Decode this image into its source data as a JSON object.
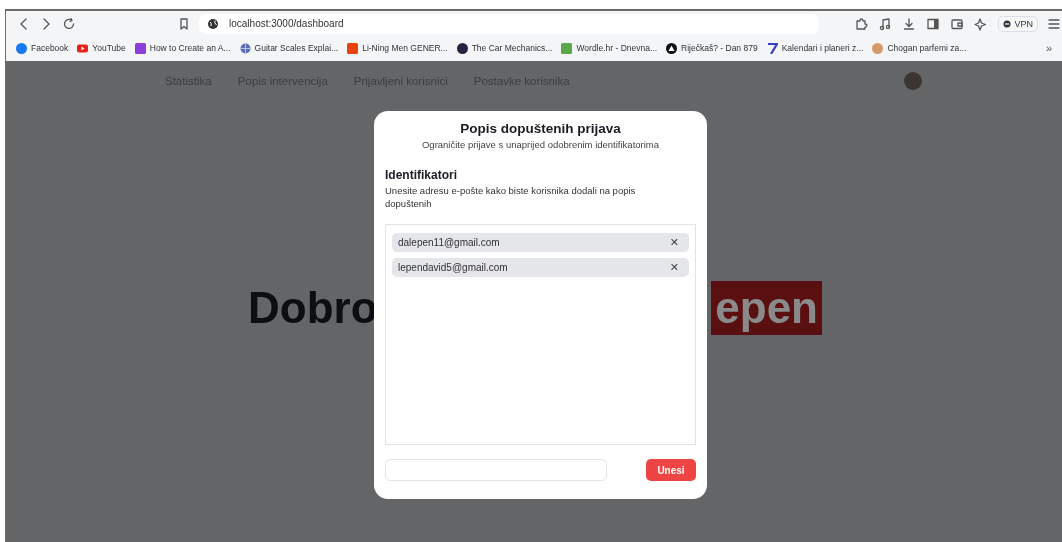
{
  "browser": {
    "address": "localhost:3000/dashboard",
    "bookmarks": [
      {
        "label": "Facebook",
        "kind": "circle",
        "color": "#1877f2"
      },
      {
        "label": "YouTube",
        "kind": "play",
        "color": "#e62117"
      },
      {
        "label": "How to Create an A...",
        "kind": "square",
        "color": "#8b3fd9"
      },
      {
        "label": "Guitar Scales Explai...",
        "kind": "globe",
        "color": "#5b6fb8"
      },
      {
        "label": "Li-Ning Men GENER...",
        "kind": "square",
        "color": "#e8420f"
      },
      {
        "label": "The Car Mechanics...",
        "kind": "circle",
        "color": "#2a2340"
      },
      {
        "label": "Wordle.hr - Dnevna...",
        "kind": "square",
        "color": "#5aa84a"
      },
      {
        "label": "Riječkaš? - Dan 879",
        "kind": "triangle",
        "color": "#111111"
      },
      {
        "label": "Kalendari i planeri z...",
        "kind": "seven",
        "color": "#3a3fc4"
      },
      {
        "label": "Chogan parfemi za...",
        "kind": "circle",
        "color": "#d69a6a"
      }
    ],
    "overflow": "»",
    "vpn": "VPN"
  },
  "nav": [
    "Statistika",
    "Popis intervencija",
    "Prijavljeni korisnici",
    "Postavke korisnika"
  ],
  "heading": {
    "left": "Dobro",
    "right": "epen"
  },
  "modal": {
    "title": "Popis dopuštenih prijava",
    "subtitle": "Ograničite prijave s unaprijed odobrenim identifikatorima",
    "section": "Identifikatori",
    "description": "Unesite adresu e-pošte kako biste korisnika dodali na popis dopuštenih",
    "emails": [
      "dalepen11@gmail.com",
      "lependavid5@gmail.com"
    ],
    "remove": "✕",
    "button": "Unesi"
  }
}
